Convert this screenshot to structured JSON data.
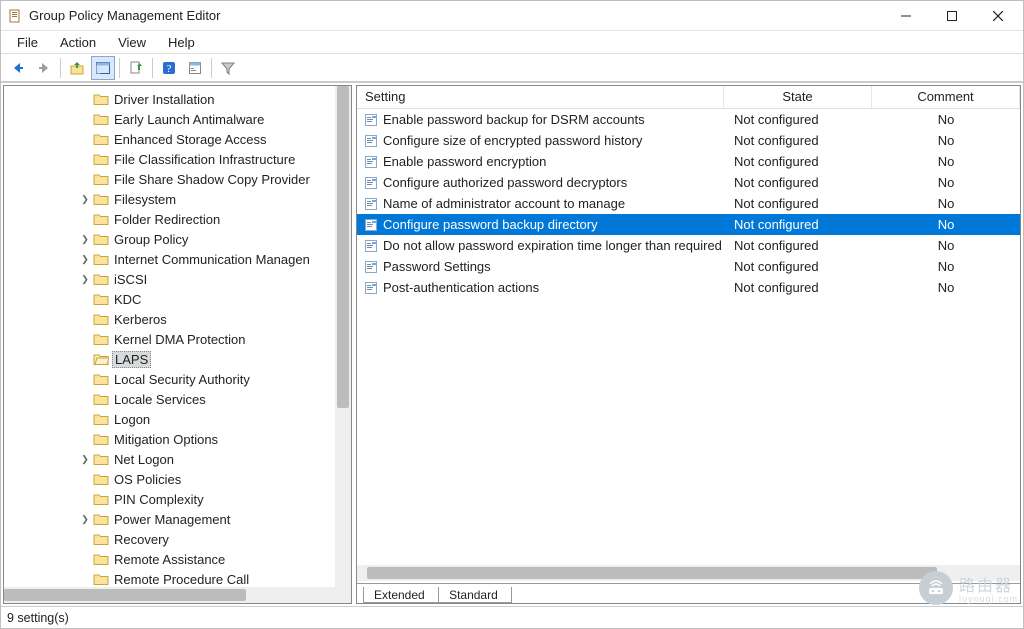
{
  "window": {
    "title": "Group Policy Management Editor"
  },
  "menu": {
    "file": "File",
    "action": "Action",
    "view": "View",
    "help": "Help"
  },
  "tree": [
    {
      "label": "Driver Installation",
      "exp": ""
    },
    {
      "label": "Early Launch Antimalware",
      "exp": ""
    },
    {
      "label": "Enhanced Storage Access",
      "exp": ""
    },
    {
      "label": "File Classification Infrastructure",
      "exp": ""
    },
    {
      "label": "File Share Shadow Copy Provider",
      "exp": ""
    },
    {
      "label": "Filesystem",
      "exp": ">"
    },
    {
      "label": "Folder Redirection",
      "exp": ""
    },
    {
      "label": "Group Policy",
      "exp": ">"
    },
    {
      "label": "Internet Communication Managen",
      "exp": ">"
    },
    {
      "label": "iSCSI",
      "exp": ">"
    },
    {
      "label": "KDC",
      "exp": ""
    },
    {
      "label": "Kerberos",
      "exp": ""
    },
    {
      "label": "Kernel DMA Protection",
      "exp": ""
    },
    {
      "label": "LAPS",
      "exp": "",
      "selected": true
    },
    {
      "label": "Local Security Authority",
      "exp": ""
    },
    {
      "label": "Locale Services",
      "exp": ""
    },
    {
      "label": "Logon",
      "exp": ""
    },
    {
      "label": "Mitigation Options",
      "exp": ""
    },
    {
      "label": "Net Logon",
      "exp": ">"
    },
    {
      "label": "OS Policies",
      "exp": ""
    },
    {
      "label": "PIN Complexity",
      "exp": ""
    },
    {
      "label": "Power Management",
      "exp": ">"
    },
    {
      "label": "Recovery",
      "exp": ""
    },
    {
      "label": "Remote Assistance",
      "exp": ""
    },
    {
      "label": "Remote Procedure Call",
      "exp": ""
    }
  ],
  "columns": {
    "setting": "Setting",
    "state": "State",
    "comment": "Comment"
  },
  "settings": [
    {
      "name": "Enable password backup for DSRM accounts",
      "state": "Not configured",
      "comment": "No"
    },
    {
      "name": "Configure size of encrypted password history",
      "state": "Not configured",
      "comment": "No"
    },
    {
      "name": "Enable password encryption",
      "state": "Not configured",
      "comment": "No"
    },
    {
      "name": "Configure authorized password decryptors",
      "state": "Not configured",
      "comment": "No"
    },
    {
      "name": "Name of administrator account to manage",
      "state": "Not configured",
      "comment": "No"
    },
    {
      "name": "Configure password backup directory",
      "state": "Not configured",
      "comment": "No",
      "selected": true
    },
    {
      "name": "Do not allow password expiration time longer than required ...",
      "state": "Not configured",
      "comment": "No"
    },
    {
      "name": "Password Settings",
      "state": "Not configured",
      "comment": "No"
    },
    {
      "name": "Post-authentication actions",
      "state": "Not configured",
      "comment": "No"
    }
  ],
  "tabs": {
    "extended": "Extended",
    "standard": "Standard"
  },
  "status": "9 setting(s)",
  "watermark": {
    "text": "路由器",
    "sub": "luyouqi.com"
  }
}
